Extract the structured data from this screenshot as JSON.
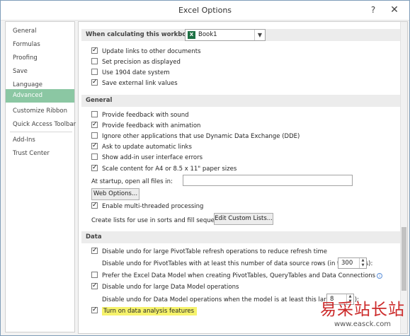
{
  "window": {
    "title": "Excel Options",
    "help": "?",
    "close": "✕"
  },
  "sidebar": {
    "items": [
      "General",
      "Formulas",
      "Proofing",
      "Save",
      "Language",
      "Advanced",
      "Customize Ribbon",
      "Quick Access Toolbar",
      "Add-Ins",
      "Trust Center"
    ],
    "active_index": 5
  },
  "workbook_section": {
    "label": "When calculating this workbook:",
    "workbook_value": "Book1",
    "options": [
      {
        "label": "Update links to other documents",
        "checked": true
      },
      {
        "label": "Set precision as displayed",
        "checked": false
      },
      {
        "label": "Use 1904 date system",
        "checked": false
      },
      {
        "label": "Save external link values",
        "checked": true
      }
    ]
  },
  "general_section": {
    "header": "General",
    "options": [
      {
        "label": "Provide feedback with sound",
        "checked": false
      },
      {
        "label": "Provide feedback with animation",
        "checked": true
      },
      {
        "label": "Ignore other applications that use Dynamic Data Exchange (DDE)",
        "checked": false
      },
      {
        "label": "Ask to update automatic links",
        "checked": true
      },
      {
        "label": "Show add-in user interface errors",
        "checked": false
      },
      {
        "label": "Scale content for A4 or 8.5 x 11\" paper sizes",
        "checked": true
      }
    ],
    "startup_label": "At startup, open all files in:",
    "startup_value": "",
    "web_options_button": "Web Options...",
    "multithread": {
      "label": "Enable multi-threaded processing",
      "checked": true
    },
    "custom_lists_label": "Create lists for use in sorts and fill sequences:",
    "custom_lists_button": "Edit Custom Lists..."
  },
  "data_section": {
    "header": "Data",
    "options": [
      {
        "label": "Disable undo for large PivotTable refresh operations to reduce refresh time",
        "checked": true
      },
      {
        "label": "Prefer the Excel Data Model when creating PivotTables, QueryTables and Data Connections",
        "checked": false
      },
      {
        "label": "Disable undo for large Data Model operations",
        "checked": true
      },
      {
        "label": "Turn on data analysis features",
        "checked": true
      }
    ],
    "pivot_rows_label": "Disable undo for PivotTables with at least this number of data source rows (in thousands):",
    "pivot_rows_value": "300",
    "model_mb_label": "Disable undo for Data Model operations when the model is at least this large (in MB):",
    "model_mb_value": "8"
  },
  "watermark": {
    "text": "易采站长站",
    "url": "www.easck.com"
  },
  "colors": {
    "active_nav": "#8bc7a3",
    "highlight": "#f6f36b",
    "excel_green": "#1e7145"
  }
}
